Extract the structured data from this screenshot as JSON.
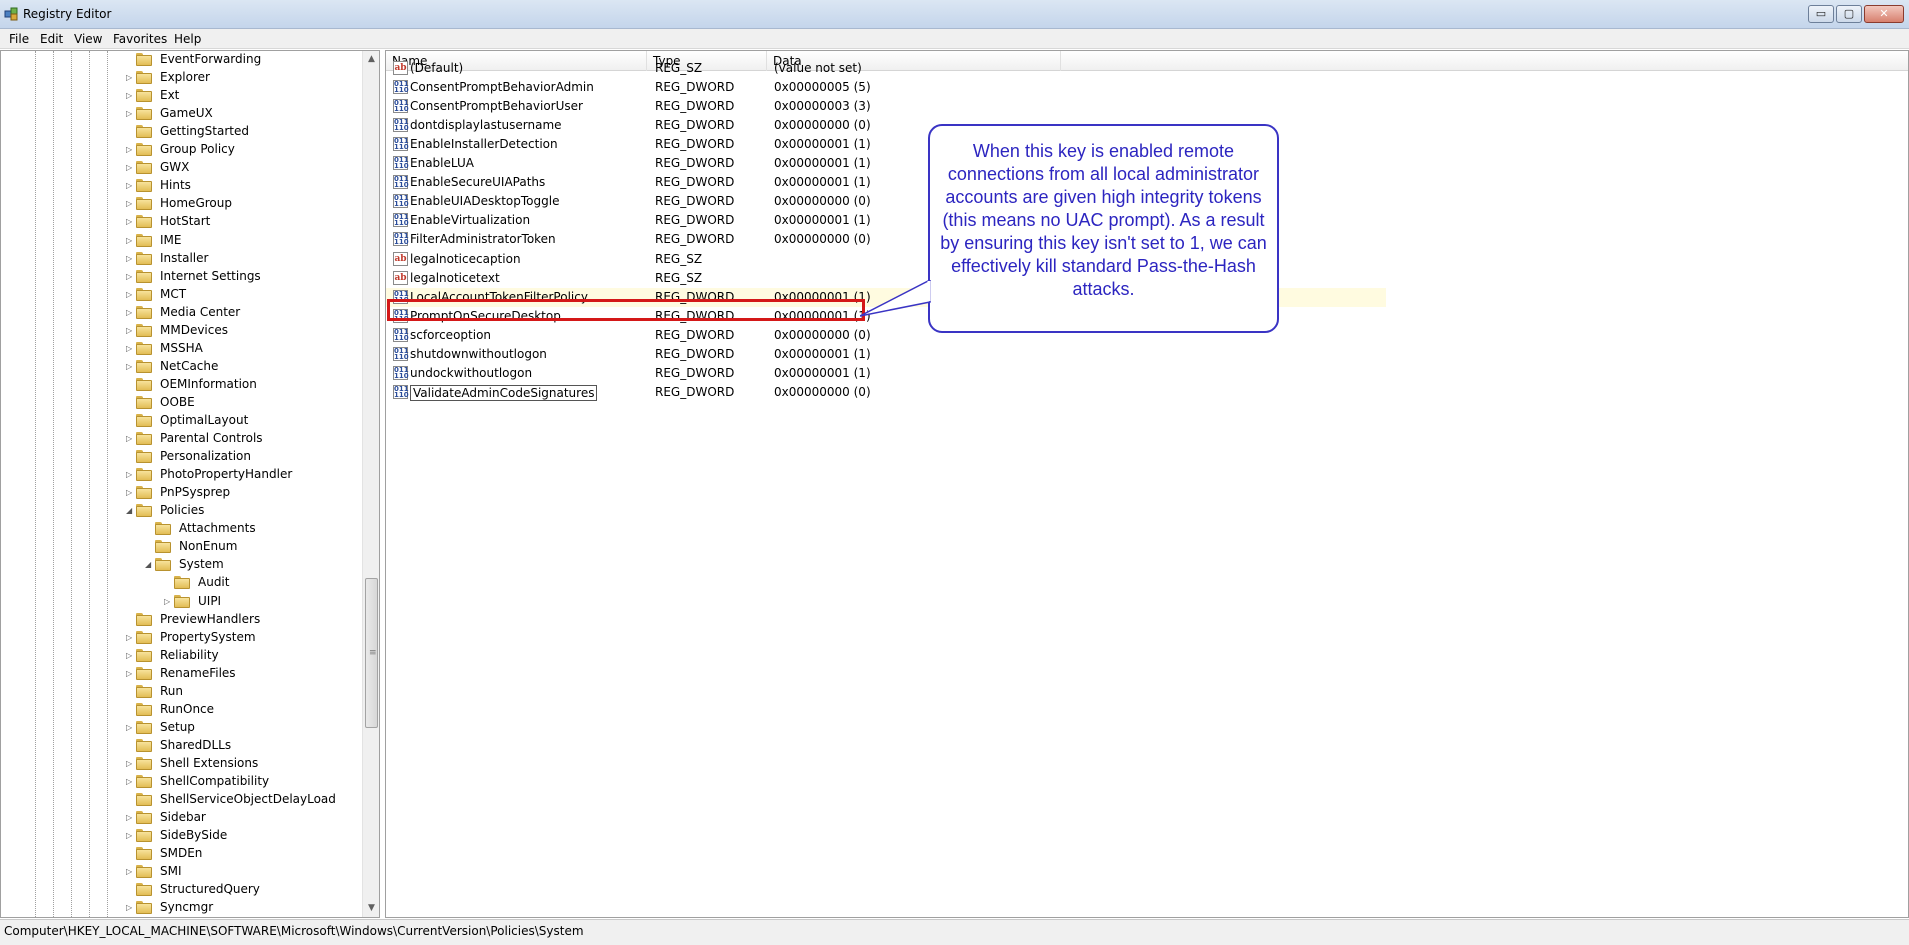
{
  "window": {
    "title": "Registry Editor",
    "controls": {
      "minimize": "▭",
      "maximize": "▢",
      "close": "✕"
    }
  },
  "menu": [
    "File",
    "Edit",
    "View",
    "Favorites",
    "Help"
  ],
  "tree": {
    "items": [
      {
        "label": "EventForwarding",
        "level": 0,
        "expander": "none"
      },
      {
        "label": "Explorer",
        "level": 0,
        "expander": "collapsed"
      },
      {
        "label": "Ext",
        "level": 0,
        "expander": "collapsed"
      },
      {
        "label": "GameUX",
        "level": 0,
        "expander": "collapsed"
      },
      {
        "label": "GettingStarted",
        "level": 0,
        "expander": "none"
      },
      {
        "label": "Group Policy",
        "level": 0,
        "expander": "collapsed"
      },
      {
        "label": "GWX",
        "level": 0,
        "expander": "collapsed"
      },
      {
        "label": "Hints",
        "level": 0,
        "expander": "collapsed"
      },
      {
        "label": "HomeGroup",
        "level": 0,
        "expander": "collapsed"
      },
      {
        "label": "HotStart",
        "level": 0,
        "expander": "collapsed"
      },
      {
        "label": "IME",
        "level": 0,
        "expander": "collapsed"
      },
      {
        "label": "Installer",
        "level": 0,
        "expander": "collapsed"
      },
      {
        "label": "Internet Settings",
        "level": 0,
        "expander": "collapsed"
      },
      {
        "label": "MCT",
        "level": 0,
        "expander": "collapsed"
      },
      {
        "label": "Media Center",
        "level": 0,
        "expander": "collapsed"
      },
      {
        "label": "MMDevices",
        "level": 0,
        "expander": "collapsed"
      },
      {
        "label": "MSSHA",
        "level": 0,
        "expander": "collapsed"
      },
      {
        "label": "NetCache",
        "level": 0,
        "expander": "collapsed"
      },
      {
        "label": "OEMInformation",
        "level": 0,
        "expander": "none"
      },
      {
        "label": "OOBE",
        "level": 0,
        "expander": "none"
      },
      {
        "label": "OptimalLayout",
        "level": 0,
        "expander": "none"
      },
      {
        "label": "Parental Controls",
        "level": 0,
        "expander": "collapsed"
      },
      {
        "label": "Personalization",
        "level": 0,
        "expander": "none"
      },
      {
        "label": "PhotoPropertyHandler",
        "level": 0,
        "expander": "collapsed"
      },
      {
        "label": "PnPSysprep",
        "level": 0,
        "expander": "collapsed"
      },
      {
        "label": "Policies",
        "level": 0,
        "expander": "expanded"
      },
      {
        "label": "Attachments",
        "level": 1,
        "expander": "none"
      },
      {
        "label": "NonEnum",
        "level": 1,
        "expander": "none"
      },
      {
        "label": "System",
        "level": 1,
        "expander": "expanded"
      },
      {
        "label": "Audit",
        "level": 2,
        "expander": "none"
      },
      {
        "label": "UIPI",
        "level": 2,
        "expander": "collapsed"
      },
      {
        "label": "PreviewHandlers",
        "level": 0,
        "expander": "none"
      },
      {
        "label": "PropertySystem",
        "level": 0,
        "expander": "collapsed"
      },
      {
        "label": "Reliability",
        "level": 0,
        "expander": "collapsed"
      },
      {
        "label": "RenameFiles",
        "level": 0,
        "expander": "collapsed"
      },
      {
        "label": "Run",
        "level": 0,
        "expander": "none"
      },
      {
        "label": "RunOnce",
        "level": 0,
        "expander": "none"
      },
      {
        "label": "Setup",
        "level": 0,
        "expander": "collapsed"
      },
      {
        "label": "SharedDLLs",
        "level": 0,
        "expander": "none"
      },
      {
        "label": "Shell Extensions",
        "level": 0,
        "expander": "collapsed"
      },
      {
        "label": "ShellCompatibility",
        "level": 0,
        "expander": "collapsed"
      },
      {
        "label": "ShellServiceObjectDelayLoad",
        "level": 0,
        "expander": "none"
      },
      {
        "label": "Sidebar",
        "level": 0,
        "expander": "collapsed"
      },
      {
        "label": "SideBySide",
        "level": 0,
        "expander": "collapsed"
      },
      {
        "label": "SMDEn",
        "level": 0,
        "expander": "none"
      },
      {
        "label": "SMI",
        "level": 0,
        "expander": "collapsed"
      },
      {
        "label": "StructuredQuery",
        "level": 0,
        "expander": "none"
      },
      {
        "label": "Syncmgr",
        "level": 0,
        "expander": "collapsed"
      }
    ],
    "scroll": {
      "up": "▲",
      "down": "▼",
      "grip": "≡"
    }
  },
  "list": {
    "columns": [
      "Name",
      "Type",
      "Data"
    ],
    "rows": [
      {
        "name": "(Default)",
        "type": "REG_SZ",
        "data": "(value not set)",
        "icon": "string-value-icon"
      },
      {
        "name": "ConsentPromptBehaviorAdmin",
        "type": "REG_DWORD",
        "data": "0x00000005 (5)",
        "icon": "dword-value-icon"
      },
      {
        "name": "ConsentPromptBehaviorUser",
        "type": "REG_DWORD",
        "data": "0x00000003 (3)",
        "icon": "dword-value-icon"
      },
      {
        "name": "dontdisplaylastusername",
        "type": "REG_DWORD",
        "data": "0x00000000 (0)",
        "icon": "dword-value-icon"
      },
      {
        "name": "EnableInstallerDetection",
        "type": "REG_DWORD",
        "data": "0x00000001 (1)",
        "icon": "dword-value-icon"
      },
      {
        "name": "EnableLUA",
        "type": "REG_DWORD",
        "data": "0x00000001 (1)",
        "icon": "dword-value-icon"
      },
      {
        "name": "EnableSecureUIAPaths",
        "type": "REG_DWORD",
        "data": "0x00000001 (1)",
        "icon": "dword-value-icon"
      },
      {
        "name": "EnableUIADesktopToggle",
        "type": "REG_DWORD",
        "data": "0x00000000 (0)",
        "icon": "dword-value-icon"
      },
      {
        "name": "EnableVirtualization",
        "type": "REG_DWORD",
        "data": "0x00000001 (1)",
        "icon": "dword-value-icon"
      },
      {
        "name": "FilterAdministratorToken",
        "type": "REG_DWORD",
        "data": "0x00000000 (0)",
        "icon": "dword-value-icon"
      },
      {
        "name": "legalnoticecaption",
        "type": "REG_SZ",
        "data": "",
        "icon": "string-value-icon"
      },
      {
        "name": "legalnoticetext",
        "type": "REG_SZ",
        "data": "",
        "icon": "string-value-icon"
      },
      {
        "name": "LocalAccountTokenFilterPolicy",
        "type": "REG_DWORD",
        "data": "0x00000001 (1)",
        "icon": "dword-value-icon",
        "highlighted": true
      },
      {
        "name": "PromptOnSecureDesktop",
        "type": "REG_DWORD",
        "data": "0x00000001 (1)",
        "icon": "dword-value-icon"
      },
      {
        "name": "scforceoption",
        "type": "REG_DWORD",
        "data": "0x00000000 (0)",
        "icon": "dword-value-icon"
      },
      {
        "name": "shutdownwithoutlogon",
        "type": "REG_DWORD",
        "data": "0x00000001 (1)",
        "icon": "dword-value-icon"
      },
      {
        "name": "undockwithoutlogon",
        "type": "REG_DWORD",
        "data": "0x00000001 (1)",
        "icon": "dword-value-icon"
      },
      {
        "name": "ValidateAdminCodeSignatures",
        "type": "REG_DWORD",
        "data": "0x00000000 (0)",
        "icon": "dword-value-icon",
        "editing": true
      }
    ],
    "icon_text": {
      "sz": "ab",
      "dw": "011\n110"
    }
  },
  "callout": {
    "text": "When this key is enabled remote connections from all local administrator accounts are given high integrity tokens (this means no UAC prompt). As a result by ensuring this key isn't set to 1, we can effectively kill standard Pass-the-Hash attacks.",
    "color": "#2c25c0"
  },
  "statusbar": {
    "path": "Computer\\HKEY_LOCAL_MACHINE\\SOFTWARE\\Microsoft\\Windows\\CurrentVersion\\Policies\\System"
  },
  "colors": {
    "highlight_border": "#d41818",
    "folder": "#e2bd55"
  }
}
